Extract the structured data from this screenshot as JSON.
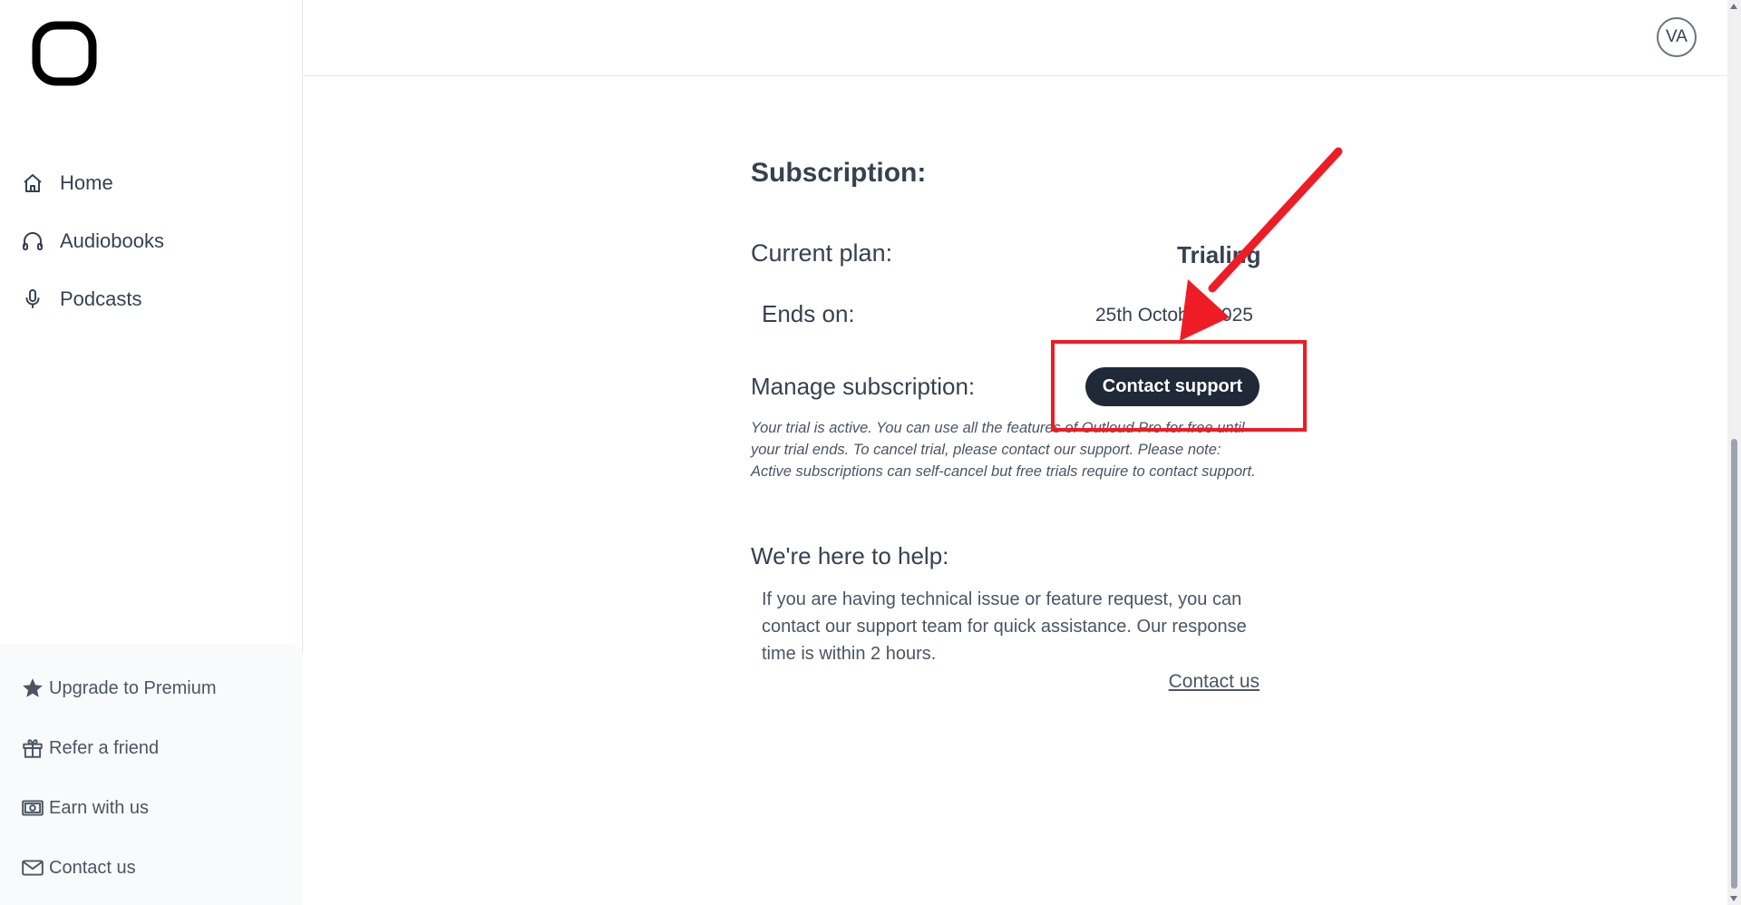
{
  "sidebar": {
    "nav": [
      {
        "label": "Home",
        "icon": "home-icon"
      },
      {
        "label": "Audiobooks",
        "icon": "headphones-icon"
      },
      {
        "label": "Podcasts",
        "icon": "microphone-icon"
      }
    ],
    "bottom": [
      {
        "label": "Upgrade to Premium",
        "icon": "star-icon"
      },
      {
        "label": "Refer a friend",
        "icon": "gift-icon"
      },
      {
        "label": "Earn with us",
        "icon": "money-icon"
      },
      {
        "label": "Contact us",
        "icon": "mail-icon"
      }
    ]
  },
  "header": {
    "avatar_initials": "VA"
  },
  "subscription": {
    "title": "Subscription:",
    "current_plan_label": "Current plan:",
    "current_plan_value": "Trialing",
    "ends_on_label": "Ends on:",
    "ends_on_value": "25th October 2025",
    "manage_label": "Manage subscription:",
    "contact_support_button": "Contact support",
    "trial_note": "Your trial is active. You can use all the features of Outloud Pro for free until your trial ends. To cancel trial, please contact our support. Please note: Active subscriptions can self-cancel but free trials require to contact support."
  },
  "help": {
    "title": "We're here to help:",
    "text": "If you are having technical issue or feature request, you can contact our support team for quick assistance. Our response time is within 2 hours.",
    "link": "Contact us"
  },
  "colors": {
    "annotation": "#ee1c24",
    "button_bg": "#1f2937",
    "text": "#374151"
  }
}
